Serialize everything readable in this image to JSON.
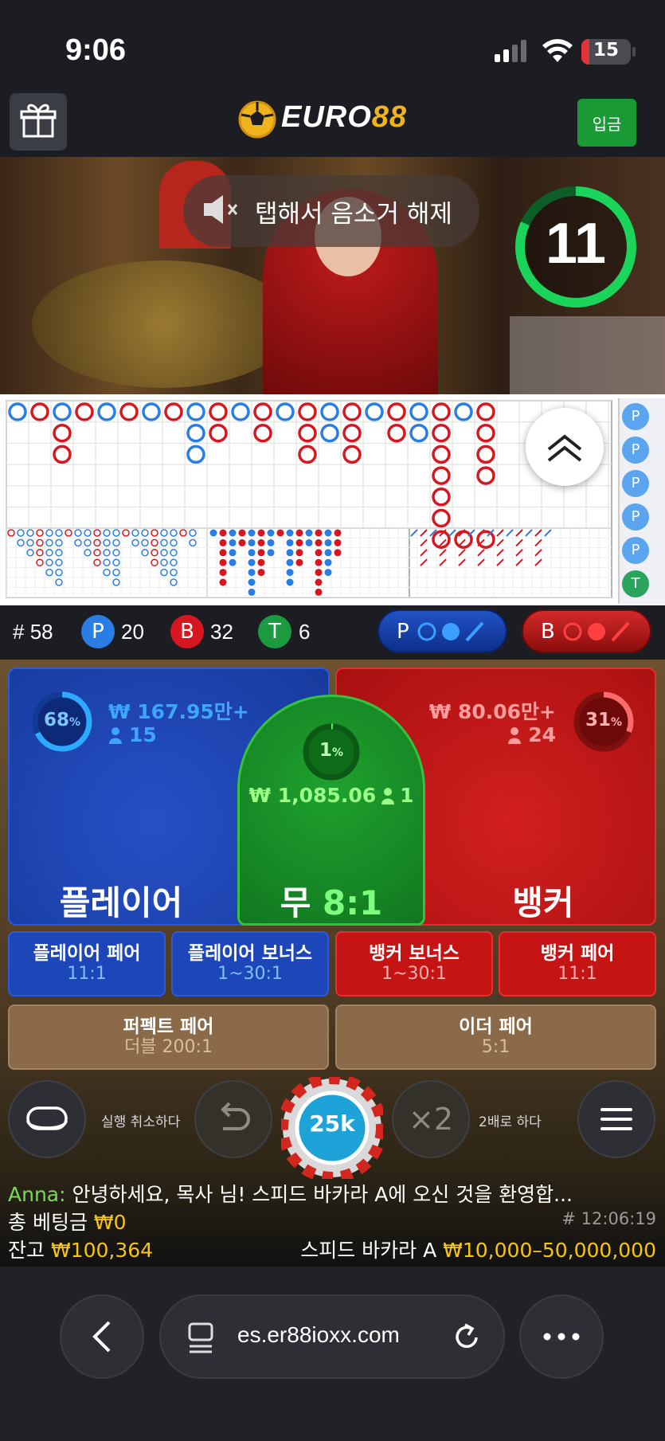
{
  "status_bar": {
    "time": "9:06",
    "battery": "15"
  },
  "header": {
    "logo_text_white": "EURO",
    "logo_text_gold": "88",
    "deposit_label": "입금"
  },
  "video": {
    "unmute_label": "탭해서 음소거 해제",
    "countdown": "11"
  },
  "roadmap": {
    "side_labels": [
      "P",
      "P",
      "P",
      "P",
      "P",
      "T"
    ]
  },
  "stats": {
    "round_label": "#",
    "round": "58",
    "player_letter": "P",
    "player_count": "20",
    "banker_letter": "B",
    "banker_count": "32",
    "tie_letter": "T",
    "tie_count": "6",
    "player_predict_letter": "P",
    "banker_predict_letter": "B"
  },
  "main_bets": {
    "player": {
      "label": "플레이어",
      "percent": "68",
      "amount": "₩ 167.95만+",
      "bettors": "15",
      "percent_value": 0.68
    },
    "tie": {
      "label": "무",
      "odds": "8:1",
      "percent": "1",
      "amount": "₩ 1,085.06",
      "bettors": "1",
      "percent_value": 0.01
    },
    "banker": {
      "label": "뱅커",
      "percent": "31",
      "amount": "₩ 80.06만+",
      "bettors": "24",
      "percent_value": 0.31
    },
    "percent_sign": "%"
  },
  "side_bets": [
    {
      "title": "플레이어 페어",
      "odds": "11:1"
    },
    {
      "title": "플레이어 보너스",
      "odds": "1~30:1"
    },
    {
      "title": "뱅커 보너스",
      "odds": "1~30:1"
    },
    {
      "title": "뱅커 페어",
      "odds": "11:1"
    },
    {
      "title": "퍼펙트 페어",
      "odds": "더블 200:1"
    },
    {
      "title": "이더 페어",
      "odds": "5:1"
    }
  ],
  "controls": {
    "undo_label": "실행 취소하다",
    "chip_value": "25k",
    "double_symbol": "×2",
    "double_label": "2배로 하다"
  },
  "chat": {
    "author": "Anna:",
    "message": "안녕하세요, 목사 님! 스피드 바카라 A에 오신 것을 환영합..."
  },
  "footer_info": {
    "total_bet_label": "총 베팅금",
    "total_bet_value": "₩0",
    "round_id": "# 12:06:19",
    "balance_label": "잔고",
    "balance_value": "₩100,364",
    "table_name": "스피드 바카라 A",
    "limits": "₩10,000–50,000,000"
  },
  "browser": {
    "url": "es.er88ioxx.com"
  },
  "colors": {
    "player_blue": "#1d46b8",
    "banker_red": "#c41414",
    "tie_green": "#1a9a2c",
    "gold": "#f5c518",
    "deposit_green": "#1a9a35"
  }
}
